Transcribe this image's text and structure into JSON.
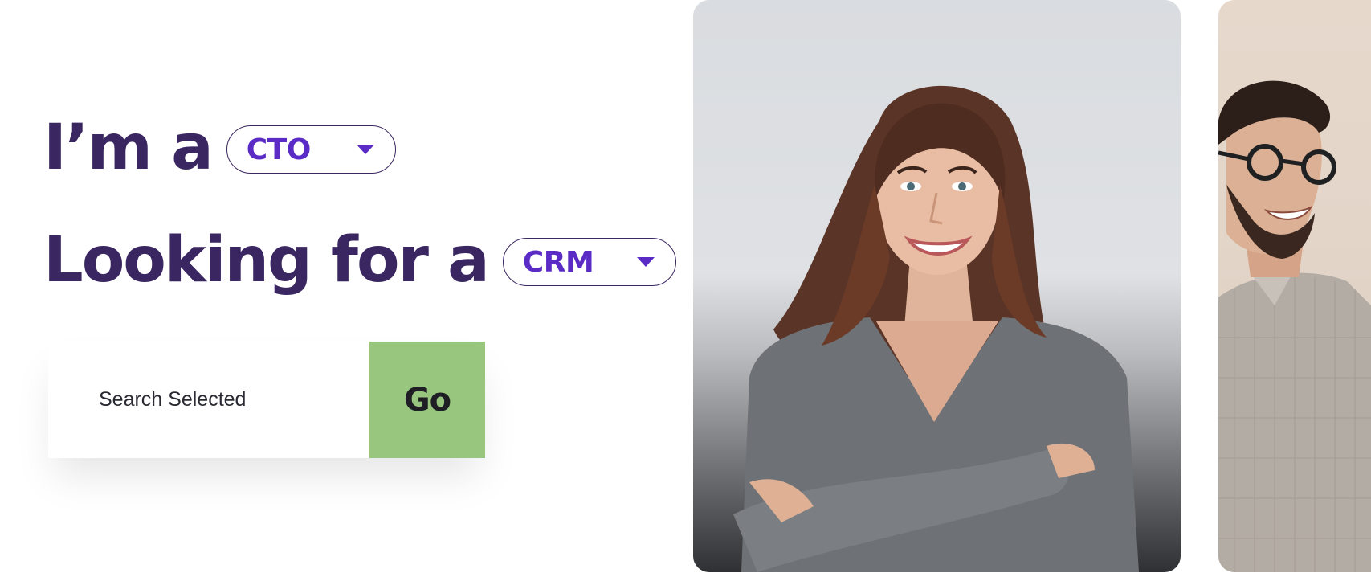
{
  "headline": {
    "line1_prefix": "I’m a",
    "role_select": {
      "value": "CTO"
    },
    "line2_prefix": "Looking for a",
    "product_select": {
      "value": "CRM"
    }
  },
  "search": {
    "label": "Search Selected",
    "go_label": "Go"
  },
  "colors": {
    "headline": "#3a2660",
    "accent": "#5b2bc6",
    "go_button": "#98c67e",
    "background": "#ffffff"
  },
  "icons": {
    "role_caret": "caret-down-icon",
    "product_caret": "caret-down-icon"
  }
}
